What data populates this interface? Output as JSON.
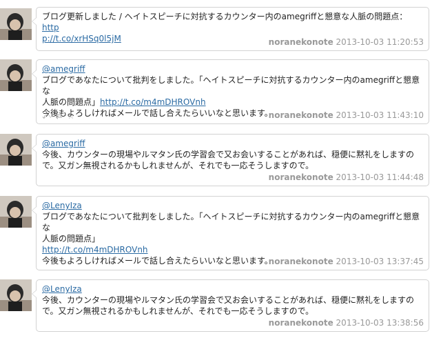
{
  "tweets": [
    {
      "line1": "ブログ更新しました / ヘイトスピーチに対抗するカウンター内のamegriffと懇意な人脈の問題点：",
      "link_a": "http",
      "link_b": "p://t.co/xrHSq0l5jM",
      "user": "noranekonote",
      "time": "2013-10-03 11:20:53"
    },
    {
      "mention": "@amegriff",
      "line1": "ブログであなたについて批判をしました。「ヘイトスピーチに対抗するカウンター内のamegriffと懇意な",
      "line2": "人脈の問題点」",
      "link": "http://t.co/m4mDHROVnh",
      "line3": "今後もよろしければメールで話し合えたらいいなと思います。",
      "actions": {
        "reply": "⤺",
        "retweet": "⇄",
        "favorite": "☆"
      },
      "user": "noranekonote",
      "time": "2013-10-03 11:43:10"
    },
    {
      "mention": "@amegriff",
      "line1": "今後、カウンターの現場やルマタン氏の学習会で又お会いすることがあれば、穏便に黙礼をしますの",
      "line2": "で。又ガン無視されるかもしれませんが、それでも一応そうしますので。",
      "user": "noranekonote",
      "time": "2013-10-03 11:44:48"
    },
    {
      "mention": "@LenyIza",
      "line1": "ブログであなたについて批判をしました。「ヘイトスピーチに対抗するカウンター内のamegriffと懇意な",
      "line2": "人脈の問題点」",
      "link": "http://t.co/m4mDHROVnh",
      "line3": "今後もよろしければメールで話し合えたらいいなと思います。",
      "user": "noranekonote",
      "time": "2013-10-03 13:37:45"
    },
    {
      "mention": "@LenyIza",
      "line1": "今後、カウンターの現場やルマタン氏の学習会で又お会いすることがあれば、穏便に黙礼をしますの",
      "line2": "で。又ガン無視されるかもしれませんが、それでも一応そうしますので。",
      "user": "noranekonote",
      "time": "2013-10-03 13:38:56"
    }
  ]
}
